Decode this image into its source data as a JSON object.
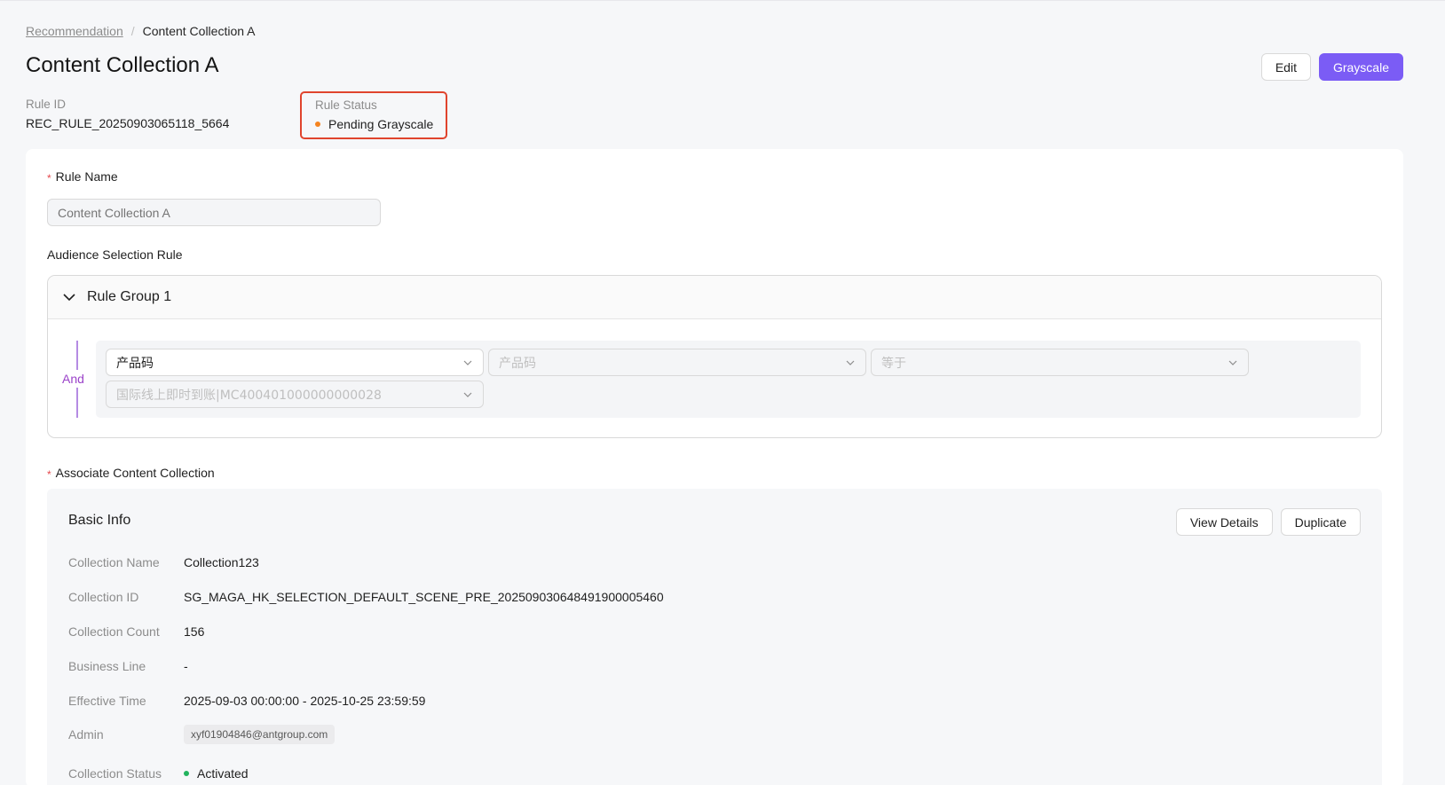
{
  "breadcrumb": {
    "parent": "Recommendation",
    "separator": "/",
    "current": "Content Collection A"
  },
  "page": {
    "title": "Content Collection A",
    "edit_label": "Edit",
    "grayscale_label": "Grayscale"
  },
  "meta": {
    "rule_id_label": "Rule ID",
    "rule_id_value": "REC_RULE_20250903065118_5664",
    "rule_status_label": "Rule Status",
    "rule_status_value": "Pending Grayscale",
    "rule_status_color": "#f5841f"
  },
  "form": {
    "rule_name_label": "Rule Name",
    "rule_name_placeholder": "Content Collection A",
    "audience_label": "Audience Selection Rule",
    "rule_group": {
      "title": "Rule Group 1",
      "connector": "And",
      "conditions": {
        "field": "产品码",
        "field_source": "产品码",
        "operator": "等于",
        "value": "国际线上即时到账|MC400401000000000028"
      }
    },
    "associate_label": "Associate Content Collection"
  },
  "collection": {
    "section_title": "Basic Info",
    "view_details_label": "View Details",
    "duplicate_label": "Duplicate",
    "rows": [
      {
        "label": "Collection Name",
        "value": "Collection123"
      },
      {
        "label": "Collection ID",
        "value": "SG_MAGA_HK_SELECTION_DEFAULT_SCENE_PRE_20250903064849190000​5460"
      },
      {
        "label": "Collection Count",
        "value": "156"
      },
      {
        "label": "Business Line",
        "value": "-"
      },
      {
        "label": "Effective Time",
        "value": "2025-09-03 00:00:00 - 2025-10-25 23:59:59"
      },
      {
        "label": "Admin",
        "value": "xyf01904846@antgroup.com"
      },
      {
        "label": "Collection Status",
        "value": "Activated"
      }
    ],
    "status_color": "#22b35e"
  },
  "colors": {
    "primary": "#7b5cf5",
    "highlight_border": "#e0442d",
    "connector": "#9b43c9"
  }
}
